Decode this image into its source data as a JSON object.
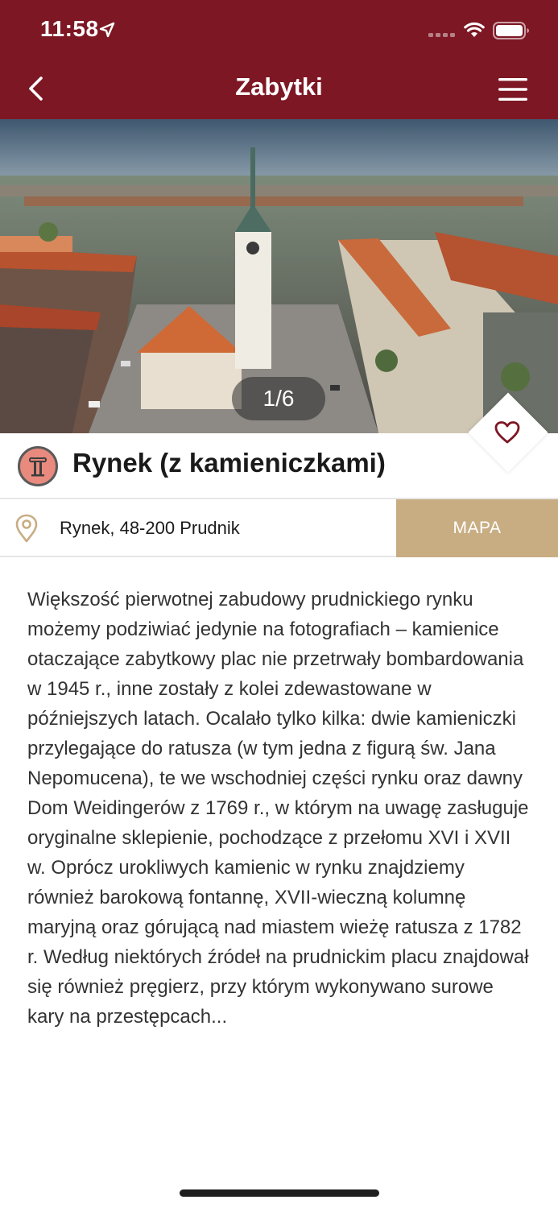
{
  "status_bar": {
    "time": "11:58"
  },
  "nav": {
    "title": "Zabytki"
  },
  "hero": {
    "page_indicator": "1/6"
  },
  "place": {
    "title": "Rynek (z kamieniczkami)",
    "category_icon": "column-icon",
    "address": "Rynek, 48-200 Prudnik",
    "map_button_label": "MAPA",
    "description": "Większość pierwotnej zabudowy prudnickiego rynku możemy podziwiać jedynie na fotografiach – kamienice otaczające zabytkowy plac nie przetrwały bombardowania w 1945 r., inne zostały z kolei zdewastowane w późniejszych latach. Ocalało tylko kilka: dwie kamieniczki przylegające do ratusza (w tym jedna z figurą św. Jana Nepomucena), te we wschodniej części rynku oraz dawny Dom Weidingerów z 1769 r., w którym na uwagę zasługuje oryginalne sklepienie, pochodzące z przełomu XVI i XVII w. Oprócz urokliwych kamienic w rynku znajdziemy również barokową fontannę, XVII-wieczną kolumnę maryjną oraz górującą nad miastem wieżę ratusza z 1782 r. Według niektórych źródeł na prudnickim placu znajdował się również pręgierz, przy którym wykonywano surowe kary na przestępcach..."
  },
  "colors": {
    "header_bg": "#7d1724",
    "map_button_bg": "#c8ad83",
    "heart": "#7d1724",
    "category_icon_bg": "#e98a7e"
  }
}
